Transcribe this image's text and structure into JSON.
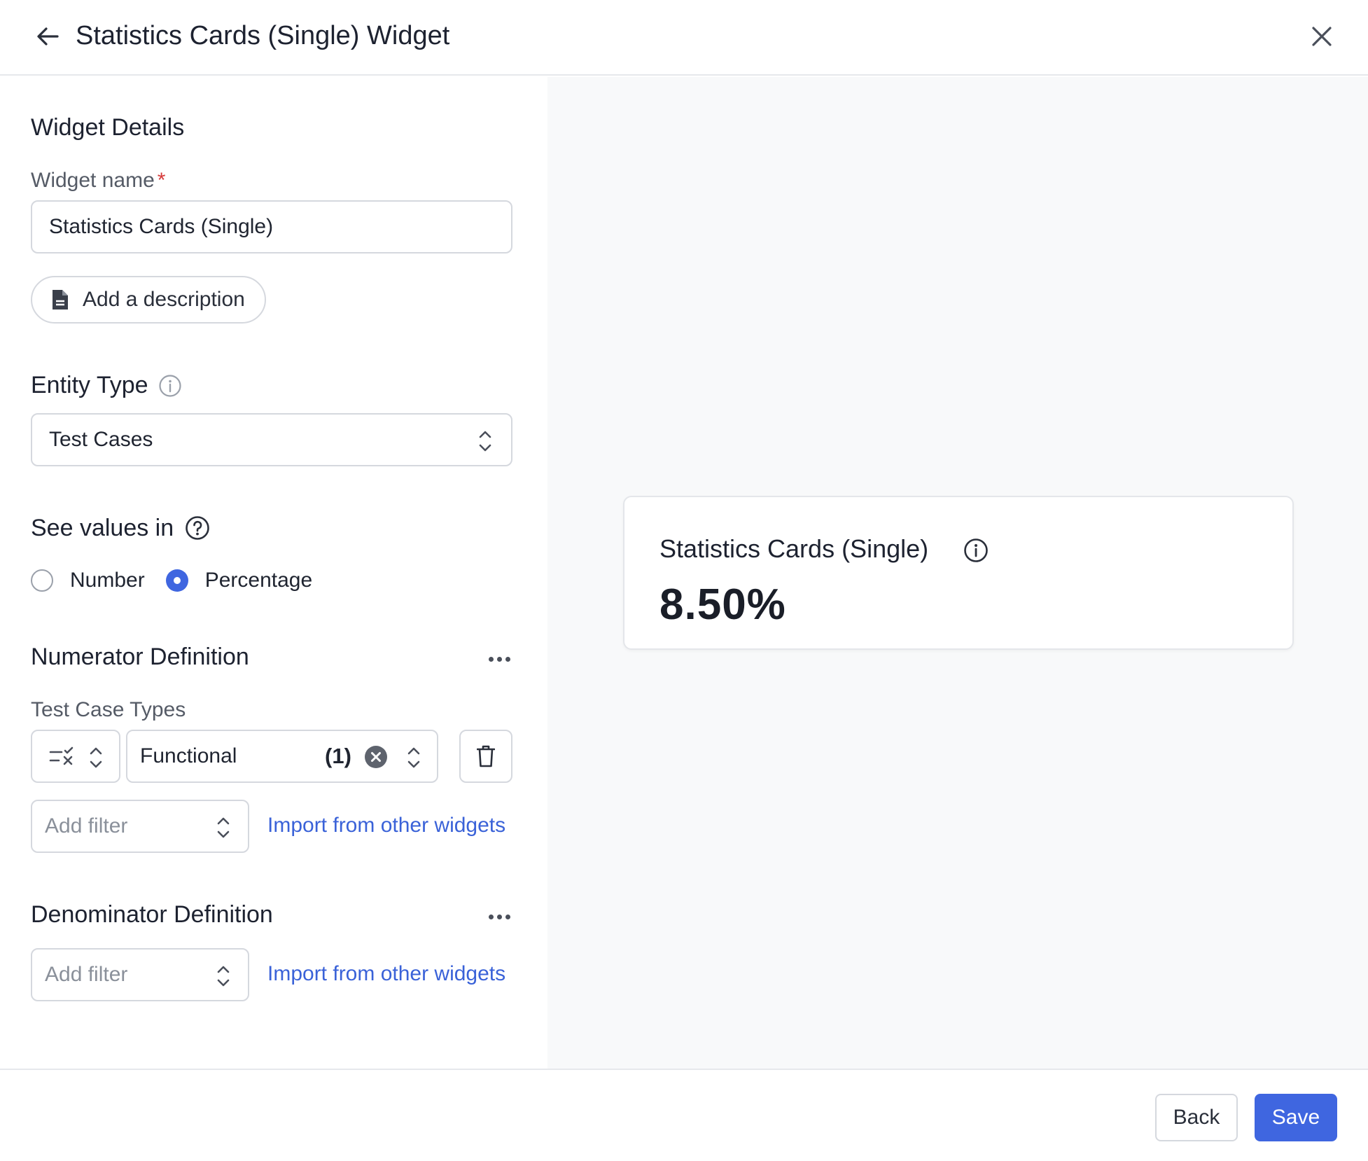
{
  "header": {
    "title": "Statistics Cards (Single) Widget"
  },
  "widget_details": {
    "section_title": "Widget Details",
    "name_label": "Widget name",
    "required_mark": "*",
    "name_value": "Statistics Cards (Single)",
    "add_description_label": "Add a description"
  },
  "entity_type": {
    "label": "Entity Type",
    "selected": "Test Cases"
  },
  "see_values": {
    "label": "See values in",
    "options": [
      "Number",
      "Percentage"
    ],
    "selected": "Percentage"
  },
  "numerator": {
    "title": "Numerator Definition",
    "filter_label": "Test Case Types",
    "filter_value": "Functional",
    "filter_count": "(1)",
    "add_filter_placeholder": "Add filter",
    "import_link": "Import from other widgets"
  },
  "denominator": {
    "title": "Denominator Definition",
    "add_filter_placeholder": "Add filter",
    "import_link": "Import from other widgets"
  },
  "preview_card": {
    "title": "Statistics Cards (Single)",
    "value": "8.50%"
  },
  "footer": {
    "back_label": "Back",
    "save_label": "Save"
  },
  "colors": {
    "accent": "#3f66e0",
    "link": "#3a62d8",
    "required": "#d63a3a",
    "preview_bg": "#f8f9fa"
  },
  "icons": [
    "arrow-left-icon",
    "close-icon",
    "document-icon",
    "info-icon",
    "help-circle-icon",
    "chevron-updown-icon",
    "more-dots-icon",
    "filter-operator-icon",
    "clear-circle-icon",
    "trash-icon"
  ]
}
